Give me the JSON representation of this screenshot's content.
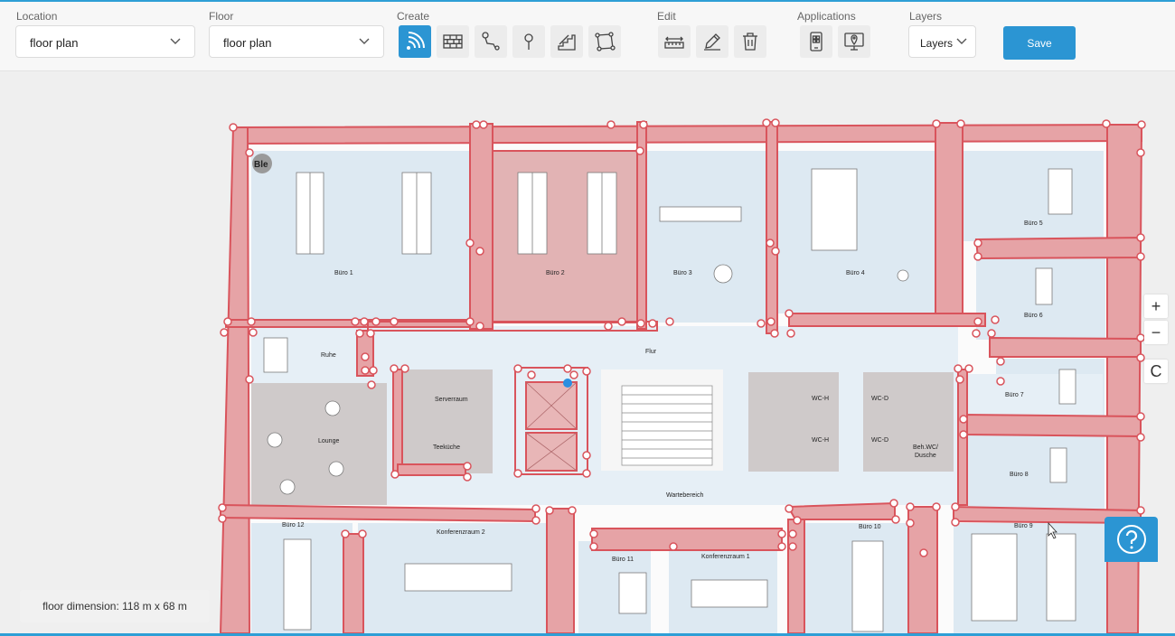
{
  "toolbar": {
    "location": {
      "label": "Location",
      "value": "floor plan"
    },
    "floor": {
      "label": "Floor",
      "value": "floor plan"
    },
    "create": {
      "label": "Create",
      "tools": [
        "ble-beacon-icon",
        "wall-icon",
        "route-icon",
        "poi-pin-icon",
        "stairs-icon",
        "polygon-icon"
      ],
      "active": "ble-beacon-icon"
    },
    "edit": {
      "label": "Edit",
      "tools": [
        "measure-icon",
        "pencil-icon",
        "trash-icon"
      ]
    },
    "applications": {
      "label": "Applications",
      "tools": [
        "mobile-qr-icon",
        "monitor-location-icon"
      ]
    },
    "layers": {
      "label": "Layers",
      "value": "Layers"
    },
    "save_label": "Save"
  },
  "map": {
    "ble_badge": "Ble",
    "rooms": [
      "Büro 1",
      "Büro 2",
      "Büro 3",
      "Büro 4",
      "Büro 5",
      "Büro 6",
      "Büro 7",
      "Büro 8",
      "Büro 9",
      "Büro 10",
      "Büro 11",
      "Büro 12",
      "Flur",
      "Ruhe",
      "Serverraum",
      "Teeküche",
      "Lounge",
      "Wartebereich",
      "WC-H",
      "WC-H",
      "WC-D",
      "WC-D",
      "Beh.WC/",
      "Dusche",
      "Konferenzraum 2",
      "Konferenzraum 1"
    ],
    "zoom_in": "+",
    "zoom_out": "−",
    "compass": "C",
    "floor_dimension": "floor dimension: 118 m x 68 m"
  },
  "help_icon": "help-question-icon",
  "colors": {
    "accent": "#2b95d3",
    "wall": "#d9545c",
    "wall_fill": "#e6a3a6",
    "room": "#dde9f2"
  }
}
